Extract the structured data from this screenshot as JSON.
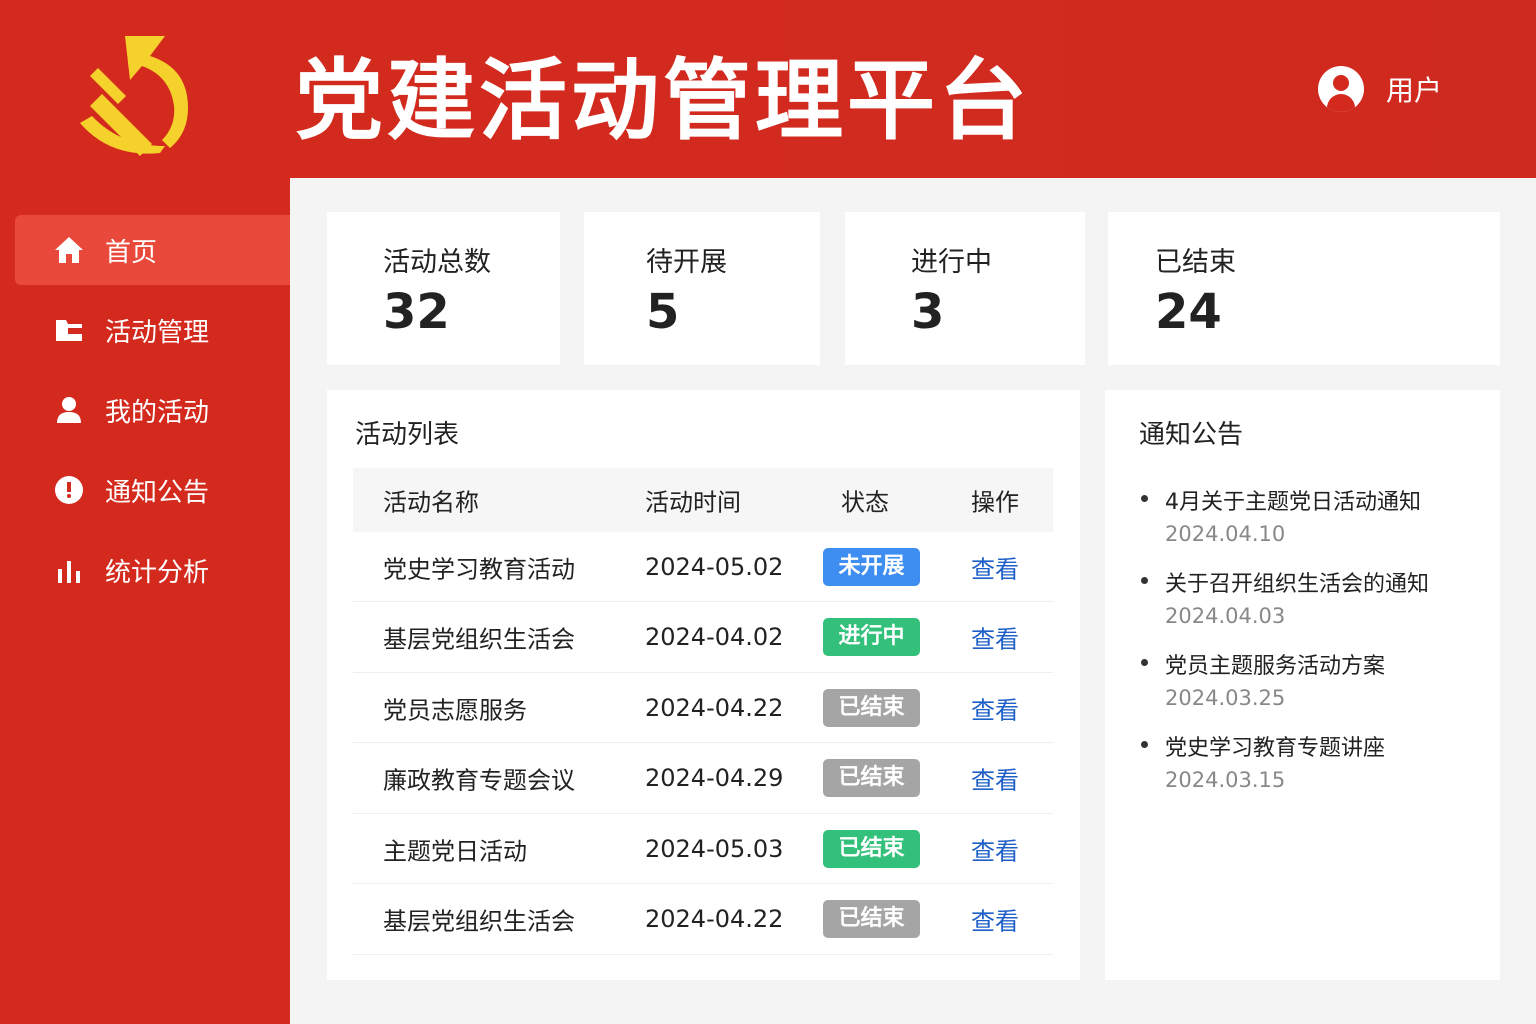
{
  "header": {
    "title": "党建活动管理平台",
    "user_label": "用户"
  },
  "colors": {
    "brand_red": "#d42a1e",
    "active_nav": "#e8493a",
    "blue": "#3d8ef0",
    "green": "#33c07a",
    "gray": "#a5a5a5",
    "link": "#1e5fc8"
  },
  "sidebar": {
    "items": [
      {
        "label": "首页",
        "icon": "home-icon"
      },
      {
        "label": "活动管理",
        "icon": "folder-icon"
      },
      {
        "label": "我的活动",
        "icon": "user-icon"
      },
      {
        "label": "通知公告",
        "icon": "info-icon"
      },
      {
        "label": "统计分析",
        "icon": "bar-chart-icon"
      }
    ]
  },
  "stats": [
    {
      "label": "活动总数",
      "value": "32"
    },
    {
      "label": "待开展",
      "value": "5"
    },
    {
      "label": "进行中",
      "value": "3"
    },
    {
      "label": "已结束",
      "value": "24"
    }
  ],
  "activity_list": {
    "title": "活动列表",
    "columns": [
      "活动名称",
      "活动时间",
      "状态",
      "操作"
    ],
    "rows": [
      {
        "name": "党史学习教育活动",
        "date": "2024-05.02",
        "status": "未开展",
        "status_color": "blue",
        "action": "查看"
      },
      {
        "name": "基层党组织生活会",
        "date": "2024-04.02",
        "status": "进行中",
        "status_color": "green",
        "action": "查看"
      },
      {
        "name": "党员志愿服务",
        "date": "2024-04.22",
        "status": "已结束",
        "status_color": "gray",
        "action": "查看"
      },
      {
        "name": "廉政教育专题会议",
        "date": "2024-04.29",
        "status": "已结束",
        "status_color": "gray",
        "action": "查看"
      },
      {
        "name": "主题党日活动",
        "date": "2024-05.03",
        "status": "已结束",
        "status_color": "green",
        "action": "查看"
      },
      {
        "name": "基层党组织生活会",
        "date": "2024-04.22",
        "status": "已结束",
        "status_color": "gray",
        "action": "查看"
      }
    ]
  },
  "notices": {
    "title": "通知公告",
    "items": [
      {
        "title": "4月关于主题党日活动通知",
        "date": "2024.04.10"
      },
      {
        "title": "关于召开组织生活会的通知",
        "date": "2024.04.03"
      },
      {
        "title": "党员主题服务活动方案",
        "date": "2024.03.25"
      },
      {
        "title": "党史学习教育专题讲座",
        "date": "2024.03.15"
      }
    ]
  }
}
